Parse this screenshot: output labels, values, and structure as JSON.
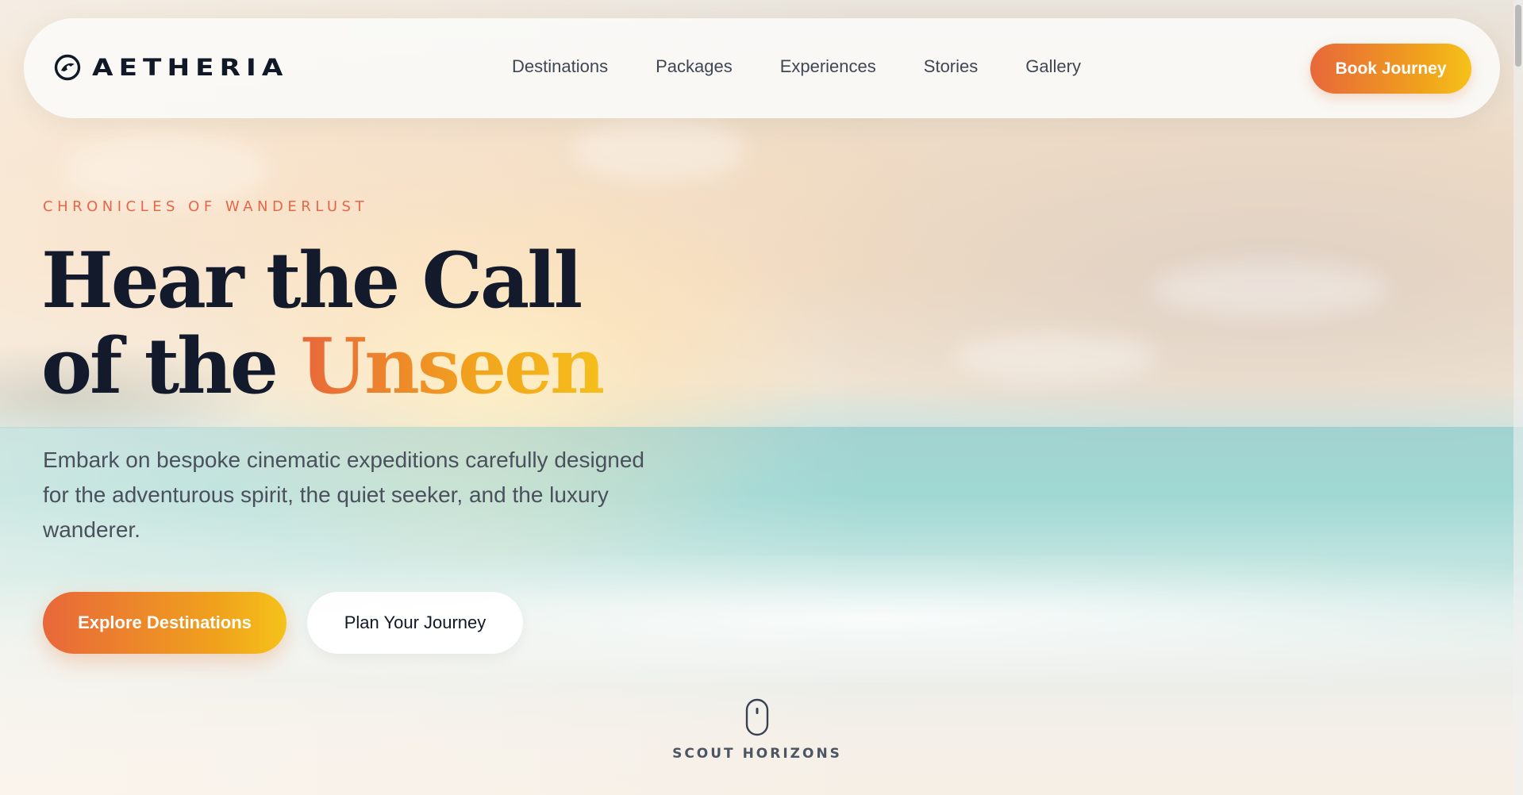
{
  "brand": {
    "name": "AETHERIA",
    "icon": "eye-logo-icon"
  },
  "nav": {
    "links": [
      {
        "label": "Destinations"
      },
      {
        "label": "Packages"
      },
      {
        "label": "Experiences"
      },
      {
        "label": "Stories"
      },
      {
        "label": "Gallery"
      }
    ],
    "cta_label": "Book Journey"
  },
  "hero": {
    "eyebrow": "CHRONICLES OF WANDERLUST",
    "headline_line1": "Hear the Call",
    "headline_line2_prefix": "of the",
    "headline_accent": "Unseen",
    "lede": "Embark on bespoke cinematic expeditions carefully designed for the adventurous spirit, the quiet seeker, and the luxury wanderer.",
    "primary_cta": "Explore Destinations",
    "secondary_cta": "Plan Your Journey"
  },
  "scroll_cue": {
    "label": "SCOUT HORIZONS",
    "icon": "mouse-scroll-icon"
  },
  "colors": {
    "accent_start": "#e8673a",
    "accent_end": "#f5c21a",
    "heading": "#121a2c",
    "eyebrow": "#e4674a"
  }
}
